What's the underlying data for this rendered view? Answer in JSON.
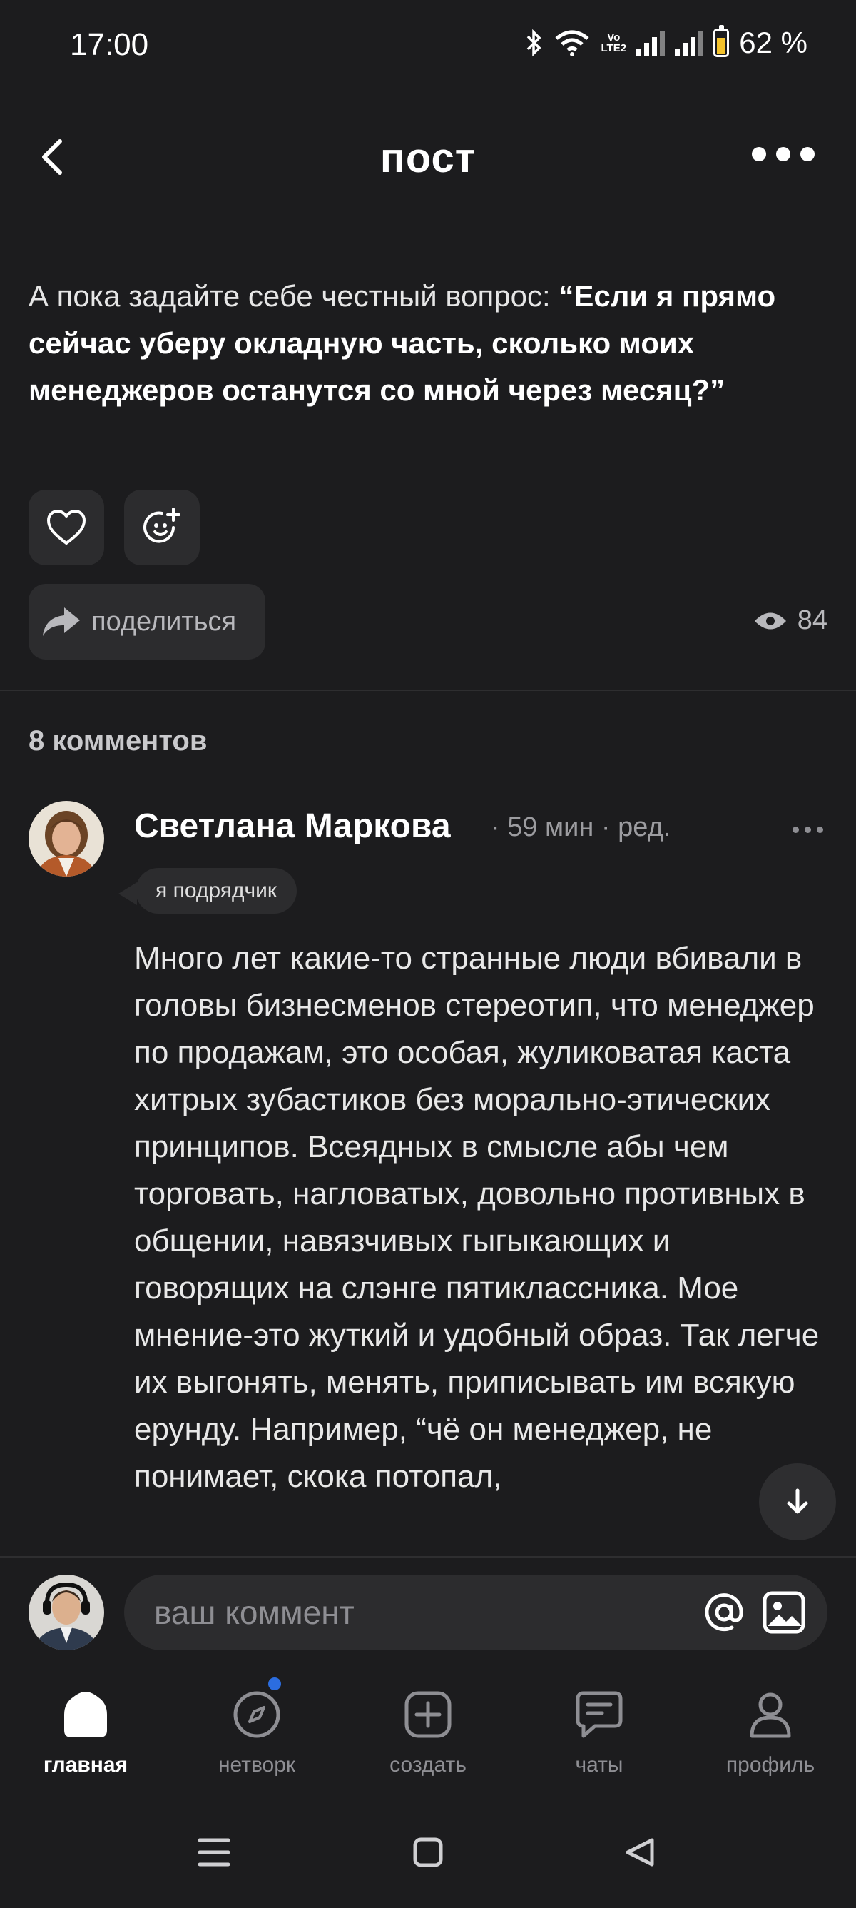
{
  "status_bar": {
    "time": "17:00",
    "battery": "62 %",
    "network": "Vo LTE2"
  },
  "header": {
    "title": "пост"
  },
  "post": {
    "text_plain": "А пока задайте себе честный вопрос: ",
    "text_bold": "“Если я прямо сейчас уберу окладную часть, сколько моих менеджеров останутся со мной через месяц?”",
    "share_label": "поделиться",
    "views": "84"
  },
  "comments": {
    "count_label": "8 комментов",
    "items": [
      {
        "author": "Светлана Маркова",
        "meta": "· 59 мин · ред.",
        "badge": "я подрядчик",
        "text": "Много лет какие-то странные люди вбивали в головы бизнесменов стереотип, что менеджер по продажам, это особая, жуликоватая каста хитрых зубастиков без морально-этических принципов. Всеядных в смысле абы чем торговать, нагловатых, довольно противных в общении, навязчивых гыгыкающих и говорящих на слэнге пятиклассника. Мое мнение-это жуткий и удобный образ. Так легче их выгонять, менять, приписывать им всякую ерунду. Например, “чё он менеджер, не понимает, скока потопал,"
      }
    ]
  },
  "comment_input": {
    "placeholder": "ваш коммент"
  },
  "bottom_nav": [
    {
      "label": "главная",
      "icon": "home-icon",
      "active": true
    },
    {
      "label": "нетворк",
      "icon": "compass-icon",
      "active": false,
      "has_dot": true
    },
    {
      "label": "создать",
      "icon": "plus-square-icon",
      "active": false
    },
    {
      "label": "чаты",
      "icon": "chat-icon",
      "active": false
    },
    {
      "label": "профиль",
      "icon": "user-icon",
      "active": false
    }
  ],
  "colors": {
    "background": "#1c1c1e",
    "surface": "#2c2c2e",
    "notification_dot": "#2b6de0"
  }
}
